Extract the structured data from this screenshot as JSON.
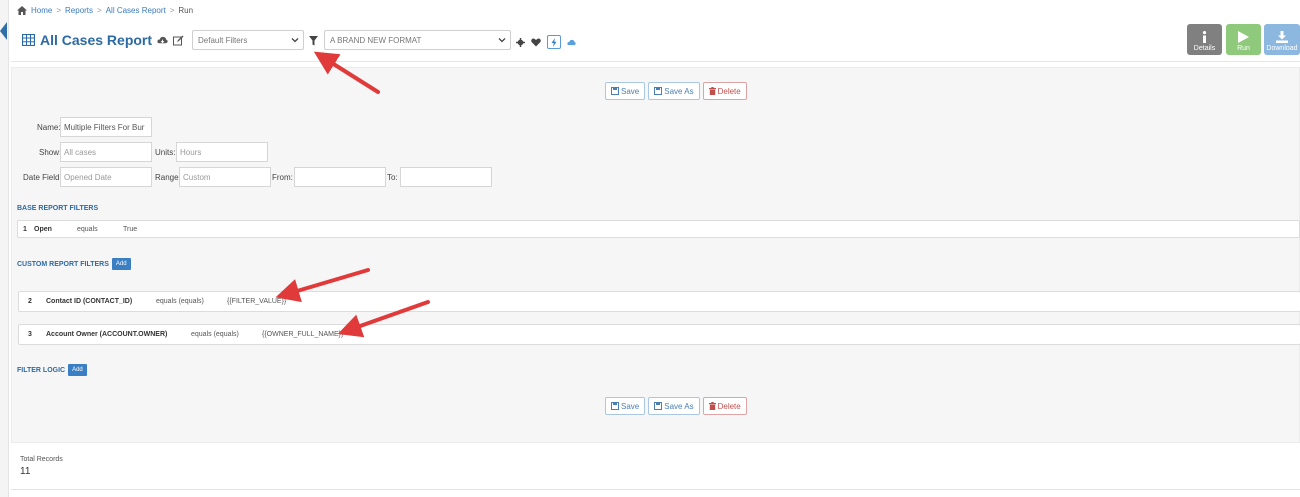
{
  "breadcrumb": {
    "items": [
      "Home",
      "Reports",
      "All Cases Report",
      "Run"
    ],
    "separator": ">"
  },
  "header": {
    "title": "All Cases Report",
    "filter_select": "Default Filters",
    "format_select": "A BRAND NEW FORMAT",
    "actions": {
      "details": "Details",
      "run": "Run",
      "download": "Download"
    }
  },
  "toolbar": {
    "save": "Save",
    "save_as": "Save As",
    "delete": "Delete"
  },
  "form": {
    "name_label": "Name:",
    "name_value": "Multiple Filters For Bur",
    "show_label": "Show:",
    "show_placeholder": "All cases",
    "units_label": "Units:",
    "units_placeholder": "Hours",
    "date_field_label": "Date Field:",
    "date_field_placeholder": "Opened Date",
    "range_label": "Range:",
    "range_placeholder": "Custom",
    "from_label": "From:",
    "to_label": "To:"
  },
  "base_filters": {
    "title": "BASE REPORT FILTERS",
    "rows": [
      {
        "num": "1",
        "field": "Open",
        "operator": "equals",
        "value": "True"
      }
    ]
  },
  "custom_filters": {
    "title": "CUSTOM REPORT FILTERS",
    "add": "Add",
    "rows": [
      {
        "num": "2",
        "field": "Contact ID (CONTACT_ID)",
        "operator": "equals (equals)",
        "value": "{{FILTER_VALUE}}"
      },
      {
        "num": "3",
        "field": "Account Owner (ACCOUNT.OWNER)",
        "operator": "equals (equals)",
        "value": "{{OWNER_FULL_NAME}}"
      }
    ]
  },
  "filter_logic": {
    "title": "FILTER LOGIC",
    "add": "Add"
  },
  "totals": {
    "label": "Total Records",
    "value": "11"
  },
  "colors": {
    "accent": "#2b6aa5",
    "annotation_arrow": "#e03a3a",
    "run": "#8fc97b",
    "details": "#808080",
    "download": "#8cb8e0"
  }
}
